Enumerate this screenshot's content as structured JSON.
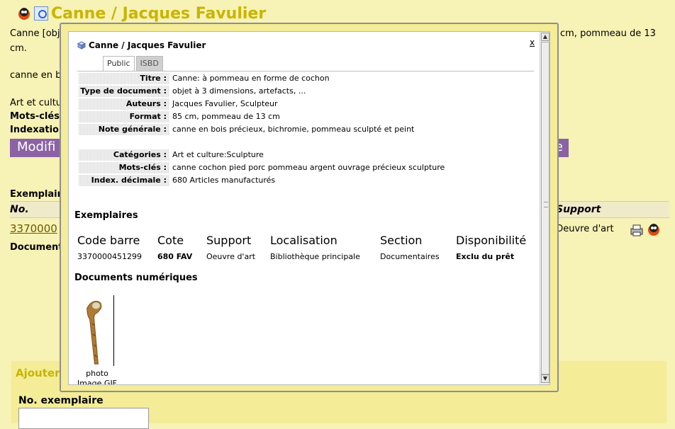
{
  "background": {
    "title": "Canne / Jacques Favulier",
    "text_line1_left": "Canne [obj",
    "text_line1_right": "cm, pommeau de 13",
    "text_line2": "cm.",
    "text_line3": "canne en b",
    "text_line4": "Art et cultu",
    "mots_cles": "Mots-clés",
    "indexation": "Indexation",
    "modify_left": "Modifi",
    "modify_right": "e",
    "exemplaires_label": "Exemplair",
    "col_no": "No.",
    "col_support": "Support",
    "barcode_link": "3370000",
    "support_value": "Oeuvre d'art",
    "documents_label": "Document",
    "form_legend": "Ajouter",
    "form_label": "No. exemplaire"
  },
  "modal": {
    "title": "Canne / Jacques Favulier",
    "close_label": "x",
    "tabs": [
      "Public",
      "ISBD"
    ],
    "properties": [
      {
        "label": "Titre :",
        "value": "Canne: à pommeau en forme de cochon"
      },
      {
        "label": "Type de document :",
        "value": "objet à 3 dimensions, artefacts, ..."
      },
      {
        "label": "Auteurs :",
        "value": "Jacques Favulier, Sculpteur"
      },
      {
        "label": "Format :",
        "value": "85 cm, pommeau de 13 cm"
      },
      {
        "label": "Note générale :",
        "value": "canne en bois précieux, bichromie, pommeau sculpté et peint"
      },
      {
        "label": "Catégories :",
        "value": "Art et culture:Sculpture"
      },
      {
        "label": "Mots-clés :",
        "value": "canne  cochon  pied  porc  pommeau argent  ouvrage précieux  sculpture"
      },
      {
        "label": "Index. décimale :",
        "value": "680 Articles manufacturés"
      }
    ],
    "exemplaires_title": "Exemplaires",
    "exemplaires_headers": [
      "Code barre",
      "Cote",
      "Support",
      "Localisation",
      "Section",
      "Disponibilité"
    ],
    "exemplaires_row": [
      "3370000451299",
      "680 FAV",
      "Oeuvre d'art",
      "Bibliothèque principale",
      "Documentaires",
      "Exclu du prêt"
    ],
    "documents_title": "Documents numériques",
    "document_caption1": "photo",
    "document_caption2": "Image GIF"
  },
  "colors": {
    "page_bg": "#f7f2b5",
    "title_color": "#c9b400",
    "purple_bar": "#8b63a5"
  },
  "icons": [
    "bug-icon",
    "magnifier-icon",
    "cube-icon",
    "printer-icon"
  ]
}
